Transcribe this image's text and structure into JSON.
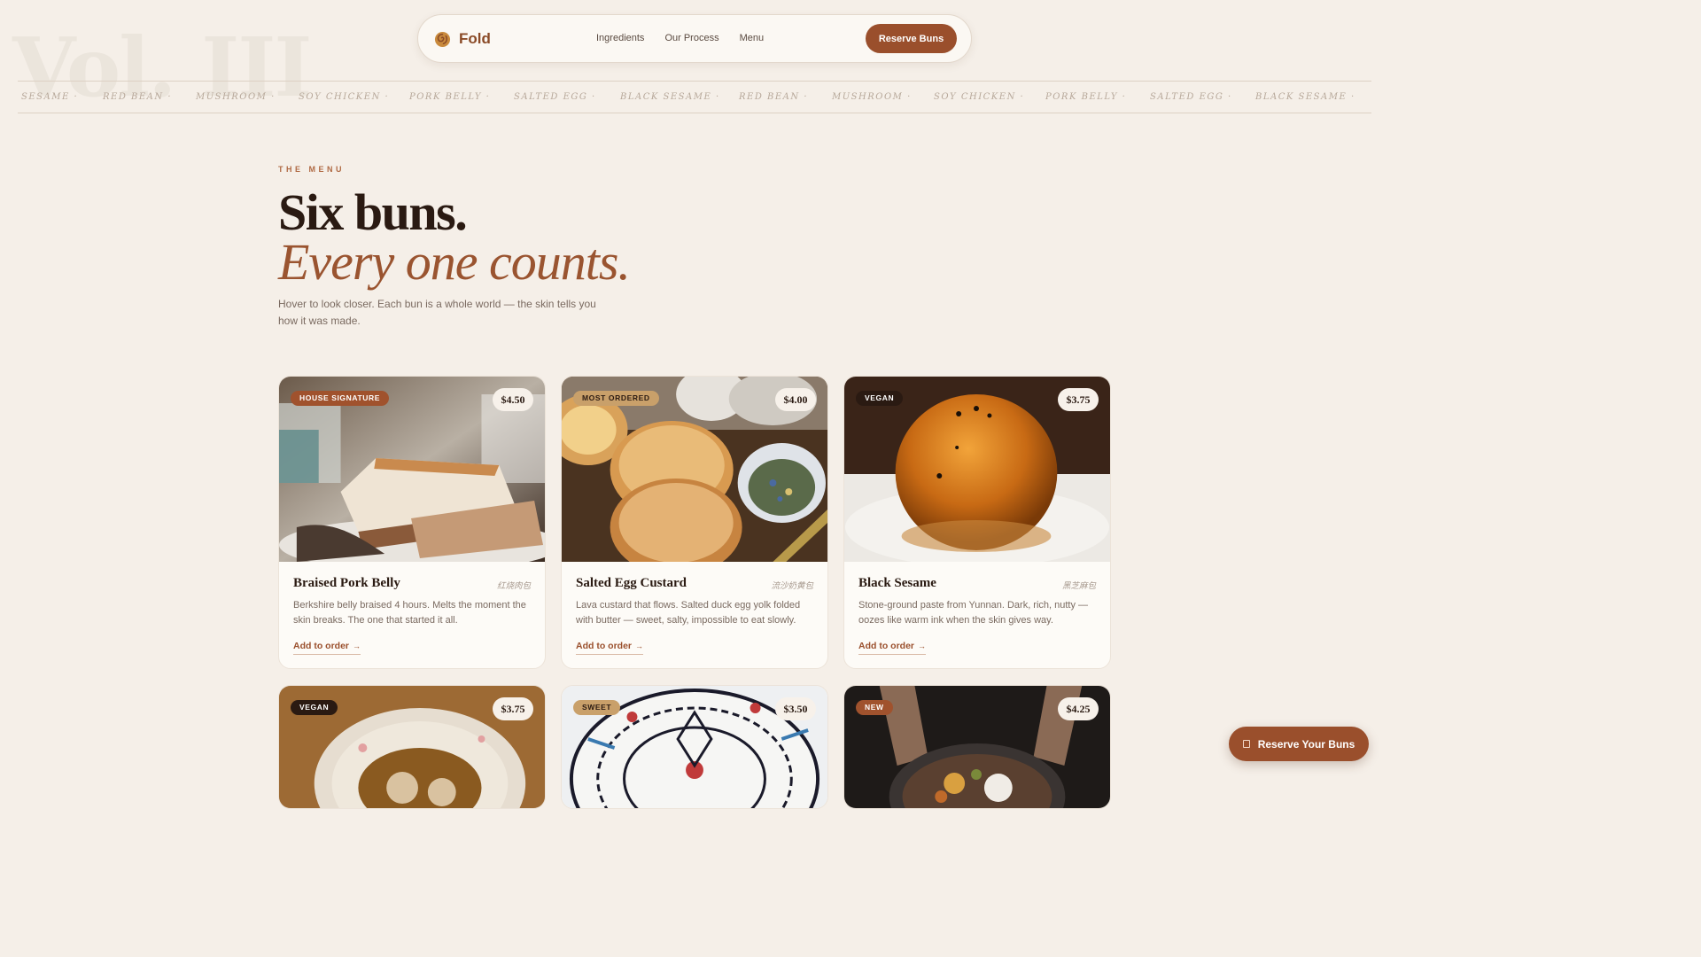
{
  "decor": {
    "vol_text": "Vol. III"
  },
  "nav": {
    "brand": "Fold",
    "links": [
      "Ingredients",
      "Our Process",
      "Menu"
    ],
    "cta": "Reserve Buns"
  },
  "ticker": [
    "SESAME ·",
    "RED BEAN ·",
    "MUSHROOM ·",
    "SOY CHICKEN ·",
    "PORK BELLY ·",
    "SALTED EGG ·",
    "BLACK SESAME ·",
    "RED BEAN ·",
    "MUSHROOM ·",
    "SOY CHICKEN ·",
    "PORK BELLY ·",
    "SALTED EGG ·",
    "BLACK SESAME ·"
  ],
  "hero": {
    "eyebrow": "THE MENU",
    "title": "Six buns.",
    "title_italic": "Every one counts.",
    "lede": "Hover to look closer. Each bun is a whole world — the skin tells you how it was made."
  },
  "cards": [
    {
      "badge": "HOUSE SIGNATURE",
      "price": "$4.50",
      "title": "Braised Pork Belly",
      "cn": "红烧肉包",
      "desc": "Berkshire belly braised 4 hours. Melts the moment the skin breaks. The one that started it all.",
      "cta": "Add to order",
      "cta_arrow": "→"
    },
    {
      "badge": "MOST ORDERED",
      "price": "$4.00",
      "title": "Salted Egg Custard",
      "cn": "流沙奶黄包",
      "desc": "Lava custard that flows. Salted duck egg yolk folded with butter — sweet, salty, impossible to eat slowly.",
      "cta": "Add to order",
      "cta_arrow": "→"
    },
    {
      "badge": "VEGAN",
      "price": "$3.75",
      "title": "Black Sesame",
      "cn": "黑芝麻包",
      "desc": "Stone-ground paste from Yunnan. Dark, rich, nutty — oozes like warm ink when the skin gives way.",
      "cta": "Add to order",
      "cta_arrow": "→"
    },
    {
      "badge": "VEGAN",
      "price": "$3.75"
    },
    {
      "badge": "SWEET",
      "price": "$3.50"
    },
    {
      "badge": "NEW",
      "price": "$4.25"
    }
  ],
  "fab": {
    "label": "Reserve Your Buns"
  },
  "colors": {
    "accent": "#9a4f2c",
    "background": "#f5efe8",
    "ink": "#2a1a12"
  }
}
